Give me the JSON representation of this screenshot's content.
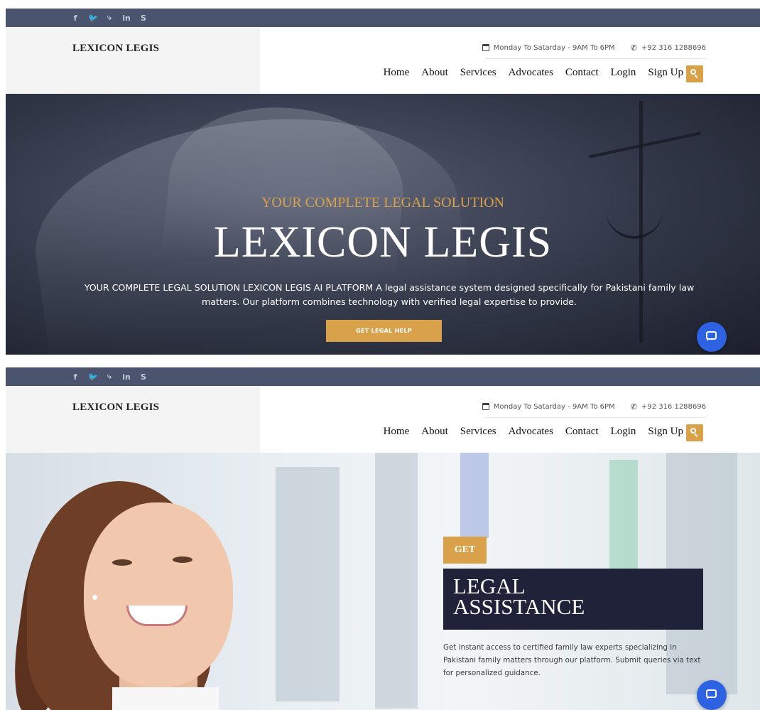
{
  "social": [
    "f",
    "🐦",
    "⤷",
    "in",
    "S"
  ],
  "header": {
    "logo": "LEXICON LEGIS",
    "hours": "Monday To Satarday - 9AM To 6PM",
    "phone": "+92 316 1288696",
    "nav": [
      "Home",
      "About",
      "Services",
      "Advocates",
      "Contact",
      "Login",
      "Sign Up"
    ]
  },
  "hero1": {
    "subtitle": "YOUR COMPLETE LEGAL SOLUTION",
    "title": "LEXICON LEGIS",
    "description": "YOUR COMPLETE LEGAL SOLUTION LEXICON LEGIS AI PLATFORM A legal assistance system designed specifically for Pakistani family law matters. Our platform combines technology with verified legal expertise to provide.",
    "button": "GET LEGAL HELP"
  },
  "hero2": {
    "tag": "GET",
    "title_line1": "LEGAL",
    "title_line2": "ASSISTANCE",
    "description": "Get instant access to certified family law experts specializing in Pakistani family matters through our platform. Submit queries via text for personalized guidance."
  },
  "colors": {
    "topbar": "#4b546e",
    "accent": "#d9a24a",
    "chat": "#2d62e3",
    "title_box": "#20223a"
  },
  "icons": {
    "calendar": "calendar-icon",
    "phone": "phone-icon",
    "search": "search-icon",
    "chat": "chat-icon"
  }
}
